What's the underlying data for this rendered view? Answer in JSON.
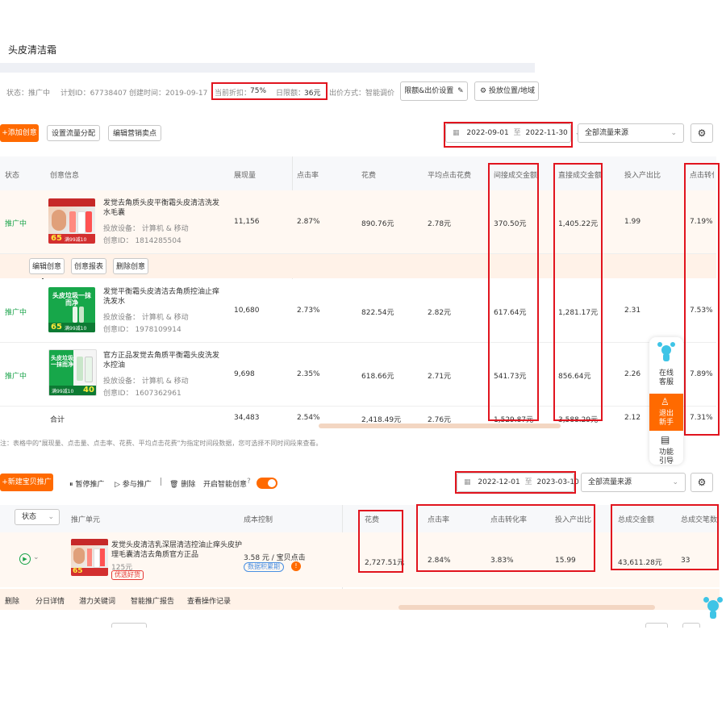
{
  "page_title": "头皮清洁霜",
  "plan_info": {
    "status": "状态：推广中",
    "plan_id": "计划ID：67738407",
    "created": "创建时间：2019-09-17",
    "discount_label": "当前折扣：",
    "discount_value": "75%",
    "budget_label": "日限额：",
    "budget_value": "36元",
    "bid_method": "出价方式：智能调价",
    "limit_button": "限额&出价设置",
    "location_button": "投放位置/地域"
  },
  "toolbar1": {
    "add_creative": "+添加创意",
    "set_traffic": "设置流量分配",
    "edit_selling": "编辑营销卖点",
    "date_from": "2022-09-01",
    "date_sep": "至",
    "date_to": "2022-11-30",
    "source_select": "全部流量来源"
  },
  "table1": {
    "headers": [
      "状态",
      "创意信息",
      "展现量",
      "点击率",
      "花费",
      "平均点击花费",
      "间接成交金额",
      "直接成交金额",
      "投入产出比",
      "点击转化"
    ],
    "rows": [
      {
        "status": "推广中",
        "title": "发觉去角质头皮平衡霜头皮清洁洗发水毛囊",
        "device": "投放设备：  计算机 & 移动",
        "creative_id": "创意ID：  1814285504",
        "impressions": "11,156",
        "ctr": "2.87%",
        "cost": "890.76元",
        "avg_cpc": "2.78元",
        "indirect": "370.50元",
        "direct": "1,405.22元",
        "roi": "1.99",
        "cvr": "7.19%",
        "img_badge": "65",
        "img_promo": "满99减10"
      },
      {
        "status": "推广中",
        "title": "发觉平衡霜头皮清洁去角质控油止痒洗发水",
        "device": "投放设备：  计算机 & 移动",
        "creative_id": "创意ID：  1978109914",
        "impressions": "10,680",
        "ctr": "2.73%",
        "cost": "822.54元",
        "avg_cpc": "2.82元",
        "indirect": "617.64元",
        "direct": "1,281.17元",
        "roi": "2.31",
        "cvr": "7.53%",
        "img_headline": "头皮垃圾一抹而净",
        "img_badge": "65",
        "img_promo": "满99减10"
      },
      {
        "status": "推广中",
        "title": "官方正品发觉去角质平衡霜头皮洗发水控油",
        "device": "投放设备：  计算机 & 移动",
        "creative_id": "创意ID：  1607362961",
        "impressions": "9,698",
        "ctr": "2.35%",
        "cost": "618.66元",
        "avg_cpc": "2.71元",
        "indirect": "541.73元",
        "direct": "856.64元",
        "roi": "2.26",
        "cvr": "7.89%",
        "img_headline": "头皮垃圾一抹而净",
        "img_promo": "满99减10",
        "img_badge": "40"
      }
    ],
    "row_actions": [
      "编辑创意",
      "创意报表",
      "删除创意"
    ],
    "total": {
      "label": "合计",
      "impressions": "34,483",
      "ctr": "2.54%",
      "cost": "2,418.49元",
      "avg_cpc": "2.76元",
      "indirect": "1,529.87元",
      "direct": "3,588.29元",
      "roi": "2.12",
      "cvr": "7.31%"
    },
    "note": "注：表格中的\"展现量、点击量、点击率、花费、平均点击花费\"为指定时间段数据，您可选择不同时间段来查看。"
  },
  "float_panel": {
    "service": "在线客服",
    "quit_newbie": "退出新手",
    "feature": "功能引导"
  },
  "toolbar2": {
    "new_promo": "+新建宝贝推广",
    "pause": "暂停推广",
    "join": "参与推广",
    "delete": "删除",
    "smart_label": "开启智能创意",
    "date_from": "2022-12-01",
    "date_sep": "至",
    "date_to": "2023-03-10",
    "source_select": "全部流量来源"
  },
  "table2": {
    "headers": [
      "状态",
      "推广单元",
      "成本控制",
      "花费",
      "点击率",
      "点击转化率",
      "投入产出比",
      "总成交金额",
      "总成交笔数"
    ],
    "row": {
      "title": "发觉头皮清洁乳深层清洁控油止痒头皮护理毛囊清洁去角质官方正品",
      "price": "125元",
      "tag": "优选好货",
      "cost_control": "3.58 元 / 宝贝点击",
      "data_tag": "数据积累期",
      "cost": "2,727.51元",
      "ctr": "2.84%",
      "cvr": "3.83%",
      "roi": "15.99",
      "gmv": "43,611.28元",
      "orders": "33",
      "img_badge": "65"
    },
    "actions": [
      "删除",
      "分日详情",
      "潜力关键词",
      "智能推广报告",
      "查看操作记录"
    ]
  },
  "colors": {
    "accent": "#ff6a00",
    "highlight_box": "#e1141e",
    "status_green": "#1aa34a"
  }
}
